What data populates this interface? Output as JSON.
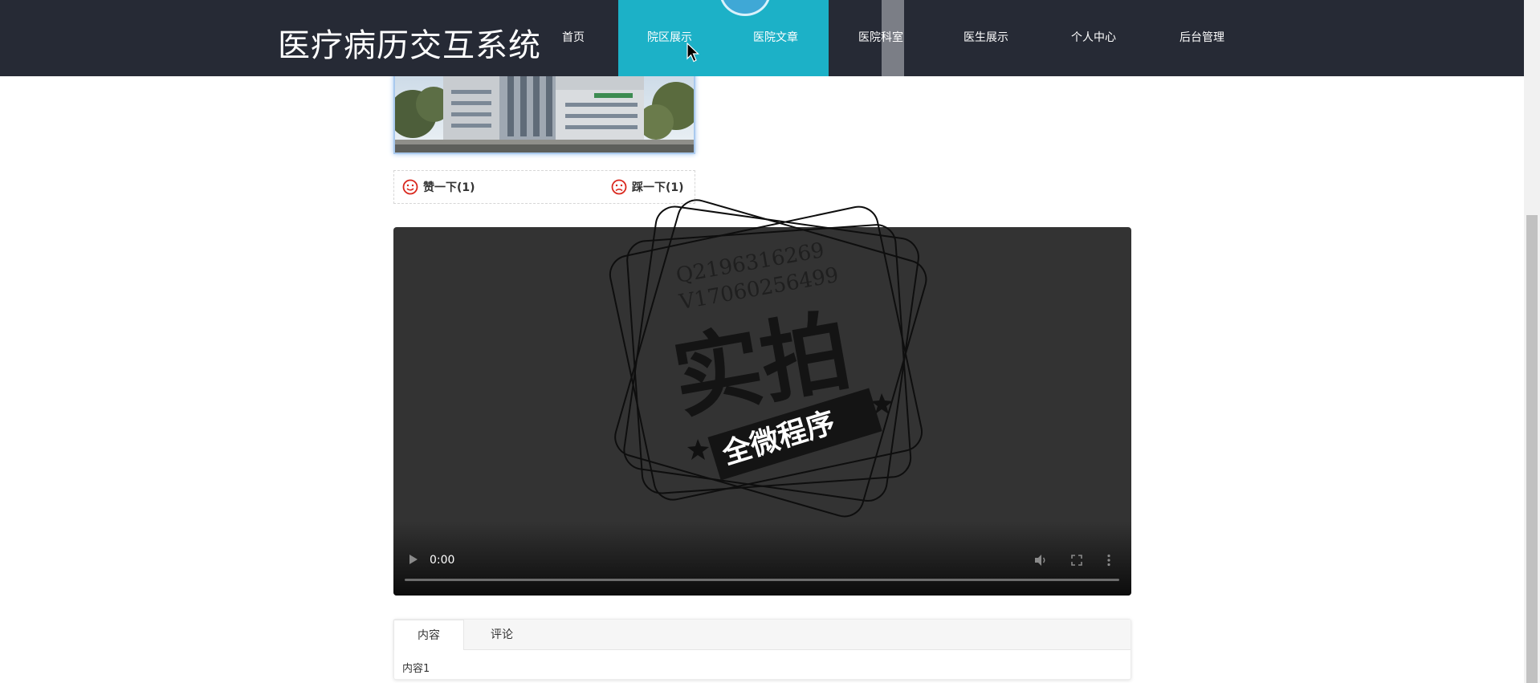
{
  "header": {
    "site_title": "医疗病历交互系统",
    "nav": [
      {
        "label": "首页"
      },
      {
        "label": "院区展示"
      },
      {
        "label": "医院文章"
      },
      {
        "label": "医院科室"
      },
      {
        "label": "医生展示"
      },
      {
        "label": "个人中心"
      },
      {
        "label": "后台管理"
      }
    ],
    "active_color": "#1cb1c7",
    "bar_color": "#262a35"
  },
  "votes": {
    "like_label": "赞一下(1)",
    "dislike_label": "踩一下(1)",
    "icon_color": "#d9261c"
  },
  "video": {
    "time": "0:00"
  },
  "watermark": {
    "line1": "Q2196316269",
    "line2": "V17060256499",
    "big": "实拍",
    "banner": "全微程序"
  },
  "tabs": {
    "items": [
      {
        "label": "内容"
      },
      {
        "label": "评论"
      }
    ],
    "content": "内容1"
  }
}
